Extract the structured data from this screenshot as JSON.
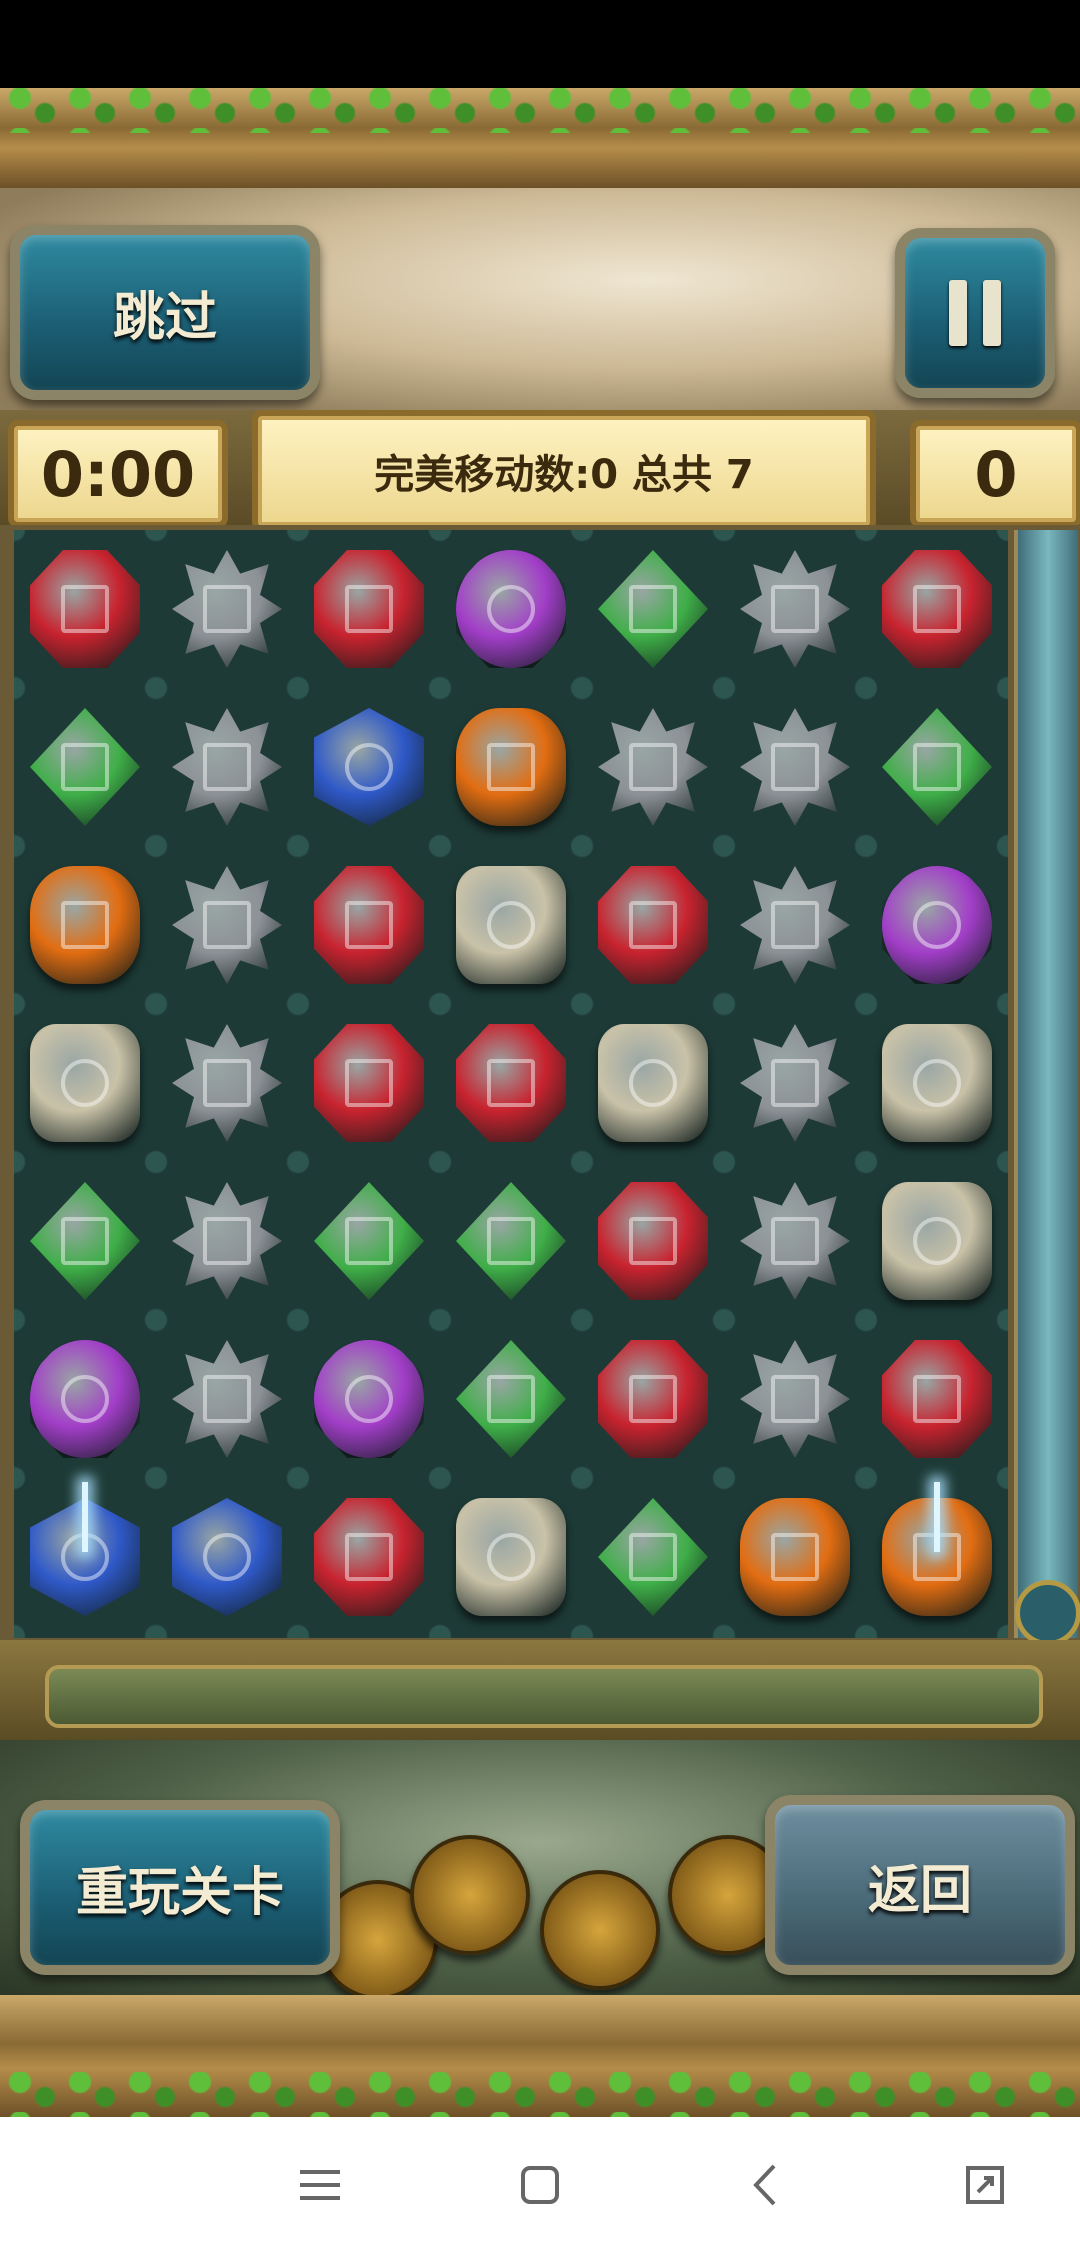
{
  "hud": {
    "skip_label": "跳过",
    "timer": "0:00",
    "moves_text": "完美移动数:0 总共 7",
    "score": "0",
    "replay_label": "重玩关卡",
    "back_label": "返回"
  },
  "board": {
    "columns": 7,
    "rows": [
      [
        "red",
        "silver",
        "red",
        "purple",
        "green",
        "silver",
        "red"
      ],
      [
        "green",
        "silver",
        "blue",
        "orange",
        "silver",
        "silver",
        "green"
      ],
      [
        "orange",
        "silver",
        "red",
        "stone",
        "red",
        "silver",
        "purple"
      ],
      [
        "stone",
        "silver",
        "red",
        "red",
        "stone",
        "silver",
        "stone"
      ],
      [
        "green",
        "silver",
        "green",
        "green",
        "red",
        "silver",
        "stone"
      ],
      [
        "purple",
        "silver",
        "purple",
        "green",
        "red",
        "silver",
        "red"
      ],
      [
        "blue-sparkle",
        "blue",
        "red",
        "stone",
        "green",
        "orange",
        "orange-sparkle"
      ]
    ]
  },
  "gem_colors": {
    "red": "#c8232f",
    "silver": "#8c9196",
    "purple": "#a23ec8",
    "green": "#3fae48",
    "blue": "#2f59c8",
    "orange": "#e26d12",
    "stone": "#c9c2a8"
  },
  "nav_icons": [
    "menu-icon",
    "home-square-icon",
    "back-chevron-icon",
    "expand-icon"
  ]
}
